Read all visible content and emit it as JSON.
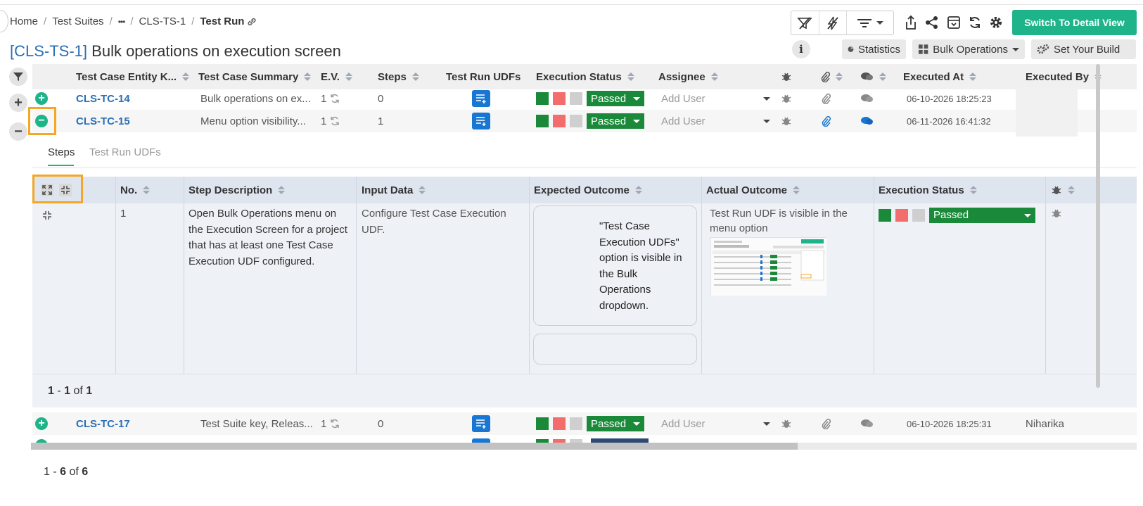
{
  "breadcrumb": {
    "items": [
      "Home",
      "Test Suites",
      "•••",
      "CLS-TS-1"
    ],
    "current": "Test Run"
  },
  "title": {
    "key": "[CLS-TS-1]",
    "text": "Bulk operations on execution screen"
  },
  "toolbar": {
    "switch_label": "Switch To Detail View",
    "info": "i",
    "statistics": "Statistics",
    "bulk_operations": "Bulk Operations",
    "set_build": "Set Your Build"
  },
  "table": {
    "headers": [
      "Test Case Entity K...",
      "Test Case Summary",
      "E.V.",
      "Steps",
      "Test Run UDFs",
      "Execution Status",
      "Assignee",
      "Executed At",
      "Executed By"
    ],
    "rows": [
      {
        "key": "CLS-TC-14",
        "summary": "Bulk operations on ex...",
        "ev": "1",
        "steps": "0",
        "status": "Passed",
        "assignee": "Add User",
        "executed_at": "06-10-2026 18:25:23",
        "executed_by": "",
        "expanded": false
      },
      {
        "key": "CLS-TC-15",
        "summary": "Menu option visibility...",
        "ev": "1",
        "steps": "1",
        "status": "Passed",
        "assignee": "Add User",
        "executed_at": "06-11-2026 16:41:32",
        "executed_by": "",
        "expanded": true
      },
      {
        "key": "CLS-TC-17",
        "summary": "Test Suite key, Releas...",
        "ev": "1",
        "steps": "0",
        "status": "Passed",
        "assignee": "Add User",
        "executed_at": "06-10-2026 18:25:31",
        "executed_by": "Niharika",
        "expanded": false
      }
    ],
    "footer": {
      "start": "1",
      "end": "6",
      "of": "of",
      "total": "6"
    }
  },
  "detail": {
    "tabs": [
      "Steps",
      "Test Run UDFs"
    ],
    "headers": [
      "No.",
      "Step Description",
      "Input Data",
      "Expected Outcome",
      "Actual Outcome",
      "Execution Status"
    ],
    "step": {
      "no": "1",
      "description": "Open Bulk Operations menu on the Execution Screen for a project that has at least one Test Case Execution UDF configured.",
      "input": "Configure Test Case Execution UDF.",
      "expected": "\"Test Case Execution UDFs\" option is visible in the Bulk Operations dropdown.",
      "actual": "Test Run UDF is visible in the menu option",
      "status": "Passed"
    },
    "footer": {
      "start": "1",
      "end": "1",
      "of": "of",
      "total": "1"
    }
  },
  "colors": {
    "accent": "#1fb389",
    "link": "#2a6fb5",
    "passed": "#1a8a3a",
    "failed": "#f36d6d",
    "highlight": "#f5a623"
  }
}
